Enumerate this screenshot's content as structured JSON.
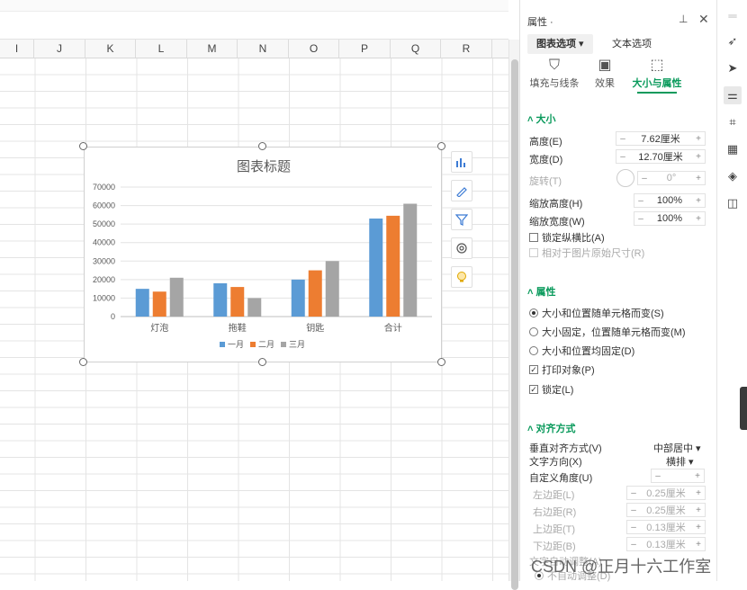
{
  "columns": [
    "I",
    "J",
    "K",
    "L",
    "M",
    "N",
    "O",
    "P",
    "Q",
    "R"
  ],
  "chart": {
    "chart_data": {
      "type": "bar",
      "title": "图表标题",
      "categories": [
        "灯泡",
        "拖鞋",
        "钥匙",
        "合计"
      ],
      "series": [
        {
          "name": "一月",
          "values": [
            15000,
            18000,
            20000,
            53000
          ],
          "color": "#5b9bd5"
        },
        {
          "name": "二月",
          "values": [
            13500,
            16000,
            25000,
            54500
          ],
          "color": "#ed7d31"
        },
        {
          "name": "三月",
          "values": [
            21000,
            10000,
            30000,
            61000
          ],
          "color": "#a5a5a5"
        }
      ],
      "ylim": [
        0,
        70000
      ],
      "yticks": [
        "70000",
        "60000",
        "50000",
        "40000",
        "30000",
        "20000",
        "10000",
        "0"
      ],
      "legend": "bottom",
      "grid": true
    }
  },
  "chart_tools": [
    "chart-elements-icon",
    "chart-style-icon",
    "chart-filter-icon",
    "chart-settings-icon",
    "chart-idea-icon"
  ],
  "panel": {
    "title": "属性 ·",
    "tabs": [
      "图表选项",
      "文本选项"
    ],
    "subtabs": [
      "填充与线条",
      "效果",
      "大小与属性"
    ],
    "size": {
      "section": "大小",
      "height_label": "高度(E)",
      "height_value": "7.62厘米",
      "width_label": "宽度(D)",
      "width_value": "12.70厘米",
      "rotate_label": "旋转(T)",
      "rotate_value": "0°",
      "scale_h_label": "缩放高度(H)",
      "scale_h_value": "100%",
      "scale_w_label": "缩放宽度(W)",
      "scale_w_value": "100%",
      "lock_ratio": "锁定纵横比(A)",
      "relative_original": "相对于图片原始尺寸(R)"
    },
    "props": {
      "section": "属性",
      "opt1": "大小和位置随单元格而变(S)",
      "opt2": "大小固定，位置随单元格而变(M)",
      "opt3": "大小和位置均固定(D)",
      "print": "打印对象(P)",
      "lock": "锁定(L)"
    },
    "align": {
      "section": "对齐方式",
      "valign_label": "垂直对齐方式(V)",
      "valign_value": "中部居中",
      "textdir_label": "文字方向(X)",
      "textdir_value": "横排",
      "angle_label": "自定义角度(U)",
      "left_label": "左边距(L)",
      "left_value": "0.25厘米",
      "right_label": "右边距(R)",
      "right_value": "0.25厘米",
      "top_label": "上边距(T)",
      "top_value": "0.13厘米",
      "bottom_label": "下边距(B)",
      "bottom_value": "0.13厘米",
      "cutoff_label": "文字自动调整(A)",
      "autofit": "不自动调整(D)"
    }
  },
  "watermark": "CSDN @正月十六工作室"
}
